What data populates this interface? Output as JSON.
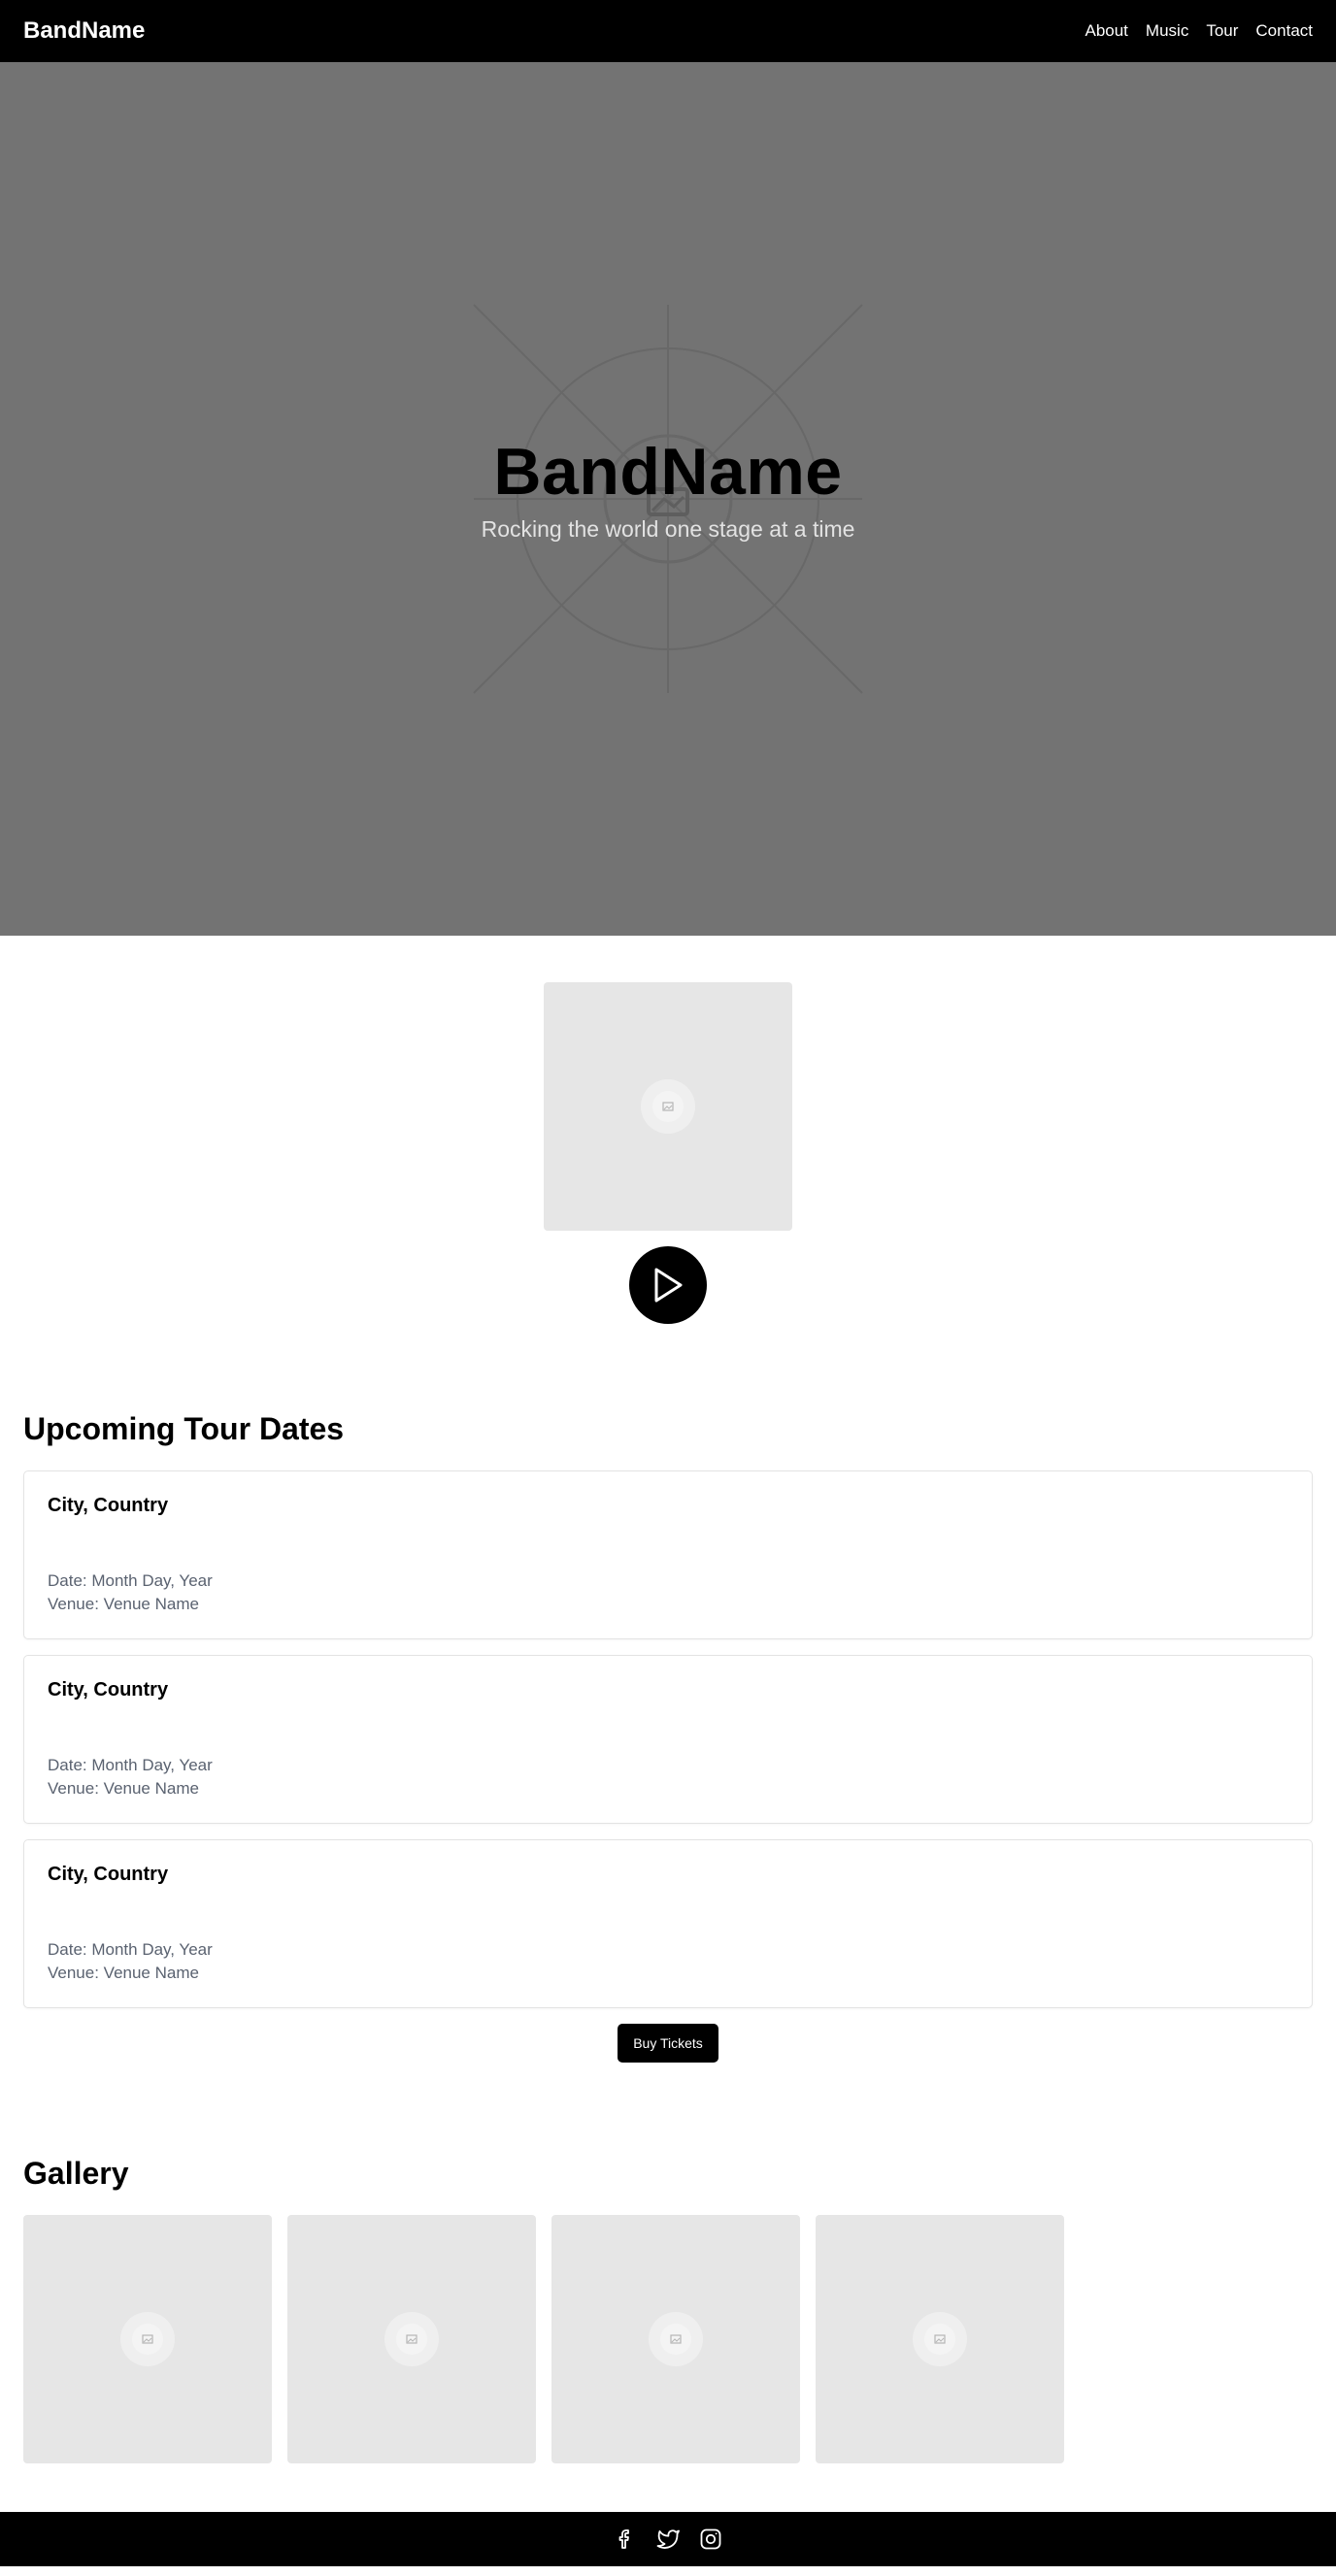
{
  "nav": {
    "brand": "BandName",
    "links": [
      {
        "label": "About"
      },
      {
        "label": "Music"
      },
      {
        "label": "Tour"
      },
      {
        "label": "Contact"
      }
    ]
  },
  "hero": {
    "title": "BandName",
    "subtitle": "Rocking the world one stage at a time"
  },
  "music": {
    "album_icon": "image-placeholder-icon",
    "play_icon": "play-icon"
  },
  "tour": {
    "title": "Upcoming Tour Dates",
    "dates": [
      {
        "city": "City, Country",
        "date": "Date: Month Day, Year",
        "venue": "Venue: Venue Name"
      },
      {
        "city": "City, Country",
        "date": "Date: Month Day, Year",
        "venue": "Venue: Venue Name"
      },
      {
        "city": "City, Country",
        "date": "Date: Month Day, Year",
        "venue": "Venue: Venue Name"
      }
    ],
    "buy_label": "Buy Tickets"
  },
  "gallery": {
    "title": "Gallery",
    "items": [
      "image-placeholder-icon",
      "image-placeholder-icon",
      "image-placeholder-icon",
      "image-placeholder-icon"
    ]
  },
  "footer": {
    "social": [
      "facebook-icon",
      "twitter-icon",
      "instagram-icon"
    ]
  },
  "colors": {
    "nav_bg": "#000000",
    "hero_bg": "#737373",
    "placeholder_bg": "#e6e6e6",
    "muted_text": "#5a6270"
  }
}
